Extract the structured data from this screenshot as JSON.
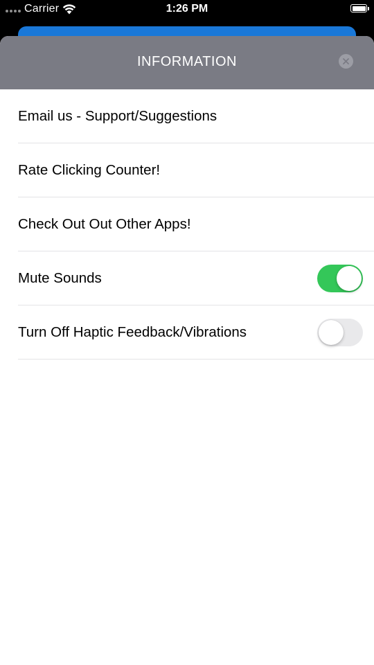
{
  "status_bar": {
    "carrier": "Carrier",
    "time": "1:26 PM"
  },
  "sheet": {
    "title": "INFORMATION",
    "close_icon": "close-circle-icon",
    "header_color": "#7a7b84"
  },
  "rows": [
    {
      "label": "Email us - Support/Suggestions"
    },
    {
      "label": "Rate Clicking Counter!"
    },
    {
      "label": "Check Out Out Other Apps!"
    },
    {
      "label": "Mute Sounds",
      "toggle": true,
      "toggle_on": true
    },
    {
      "label": "Turn Off Haptic Feedback/Vibrations",
      "toggle": true,
      "toggle_on": false
    }
  ],
  "colors": {
    "toggle_on": "#34c759",
    "toggle_off": "#e9e9eb",
    "background_card": "#1a78d8"
  }
}
